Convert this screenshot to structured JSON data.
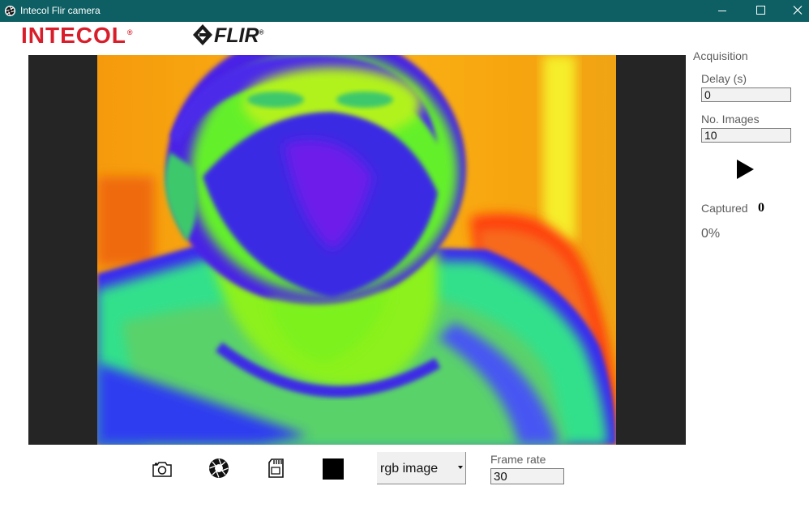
{
  "window": {
    "title": "Intecol Flir camera",
    "minimize_icon": "minimize-icon",
    "maximize_icon": "maximize-icon",
    "close_icon": "close-icon"
  },
  "logos": {
    "intecol": "INTECOL",
    "flir": "FLIR"
  },
  "acquisition": {
    "heading": "Acquisition",
    "delay_label": "Delay (s)",
    "delay_value": "0",
    "images_label": "No. Images",
    "images_value": "10",
    "captured_label": "Captured",
    "captured_value": "0",
    "progress": "0%"
  },
  "toolbar": {
    "icons": [
      "camera-icon",
      "aperture-icon",
      "sd-card-icon",
      "stop-icon"
    ],
    "mode_selected": "rgb image",
    "frame_rate_label": "Frame rate",
    "frame_rate_value": "30"
  },
  "colors": {
    "titlebar": "#0d5f63",
    "intecol_red": "#d81e2a",
    "viewer_bg": "#252525"
  }
}
